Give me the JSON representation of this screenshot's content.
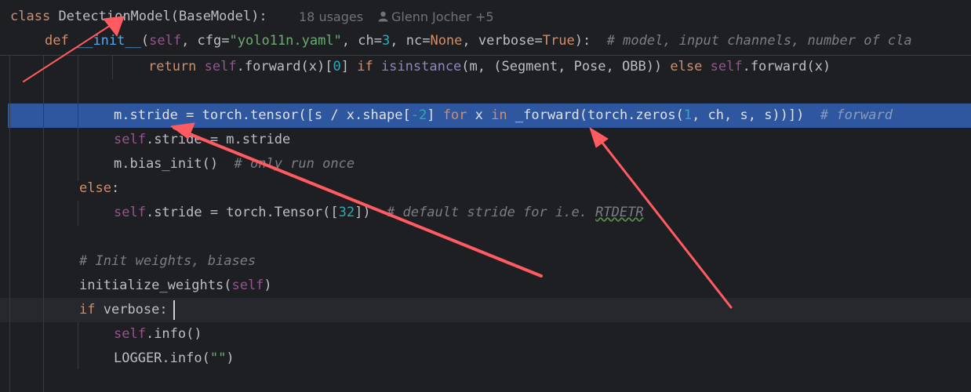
{
  "sticky_header": {
    "line1": {
      "keyword": "class",
      "class_name": "DetectionModel",
      "base_class": "BaseModel",
      "usages": "18 usages",
      "author": "Glenn Jocher +5",
      "author_icon": "user-icon"
    },
    "line2": {
      "keyword": "def",
      "func": "__init__",
      "self": "self",
      "p_cfg": "cfg=",
      "cfg_value": "\"yolo11n.yaml\"",
      "p_ch": "ch=",
      "ch_value": "3",
      "p_nc": "nc=",
      "nc_value": "None",
      "p_verbose": "verbose=",
      "verbose_value": "True",
      "comment": "# model, input channels, number of cla"
    }
  },
  "code": {
    "l_return": {
      "kw_return": "return",
      "self1": "self",
      "call1": ".forward(x)[",
      "idx": "0",
      "close": "]",
      "kw_if": "if",
      "isinstance": "isinstance",
      "args": "(m, (Segment, Pose, OBB))",
      "kw_else": "else",
      "self2": "self",
      "call2": ".forward(x)"
    },
    "l_stride": {
      "text1": "m.stride = torch.tensor([s / x.shape[",
      "num1": "-2",
      "text2": "]",
      "kw_for": "for",
      "text3": "x",
      "kw_in": "in",
      "text4": "_forward(torch.zeros(",
      "num2": "1",
      "text5": ", ch, s, s))])",
      "comment": "# forward"
    },
    "l_self_stride": {
      "self": "self",
      "rest": ".stride = m.stride"
    },
    "l_bias": {
      "code": "m.bias_init()",
      "comment": "# only run once"
    },
    "l_else": {
      "kw": "else",
      "colon": ":"
    },
    "l_default": {
      "self": "self",
      "rest": ".stride = torch.Tensor([",
      "num": "32",
      "close": "])",
      "comment_pre": "# default stride for i.e. ",
      "comment_word": "RTDETR"
    },
    "l_init_comment": "# Init weights, biases",
    "l_initialize": {
      "func": "initialize_weights(",
      "self": "self",
      "close": ")"
    },
    "l_if": {
      "kw": "if",
      "rest": "verbose:"
    },
    "l_info": {
      "self": "self",
      "rest": ".info()"
    },
    "l_logger": {
      "text": "LOGGER.info(",
      "str": "\"\"",
      "close": ")"
    }
  },
  "annotation": {
    "arrow_color": "#ff5b61",
    "arrow_count": 3
  },
  "colors": {
    "background": "#1e1f22",
    "keyword": "#cf8e6d",
    "self": "#94558d",
    "string": "#6aab73",
    "number": "#2aacb8",
    "comment": "#7a7e85",
    "selection": "#2f57a0"
  }
}
